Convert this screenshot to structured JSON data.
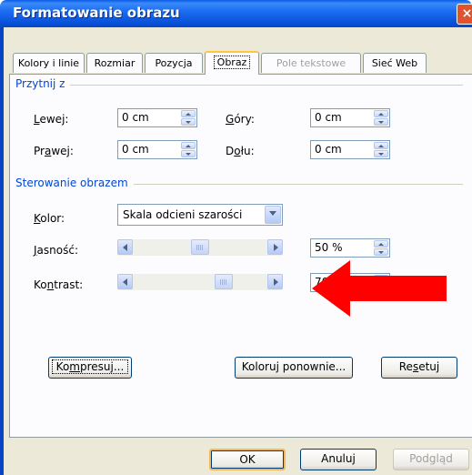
{
  "window": {
    "title": "Formatowanie obrazu",
    "close_glyph": "×"
  },
  "tabs": [
    {
      "label": "Kolory i linie",
      "active": false,
      "disabled": false
    },
    {
      "label": "Rozmiar",
      "active": false,
      "disabled": false
    },
    {
      "label": "Pozycja",
      "active": false,
      "disabled": false
    },
    {
      "label": "Obraz",
      "active": true,
      "disabled": false
    },
    {
      "label": "Pole tekstowe",
      "active": false,
      "disabled": true
    },
    {
      "label": "Sieć Web",
      "active": false,
      "disabled": false
    }
  ],
  "crop": {
    "group_label": "Przytnij z",
    "left": {
      "label_u": "L",
      "label_rest": "ewej:",
      "value": "0 cm"
    },
    "top": {
      "label_u": "G",
      "label_rest": "óry:",
      "value": "0 cm"
    },
    "right": {
      "label_pre": "Pr",
      "label_u": "a",
      "label_rest": "wej:",
      "value": "0 cm"
    },
    "bottom": {
      "label_pre": "D",
      "label_u": "o",
      "label_rest": "łu:",
      "value": "0 cm"
    }
  },
  "image_control": {
    "group_label": "Sterowanie obrazem",
    "color": {
      "label_u": "K",
      "label_rest": "olor:",
      "value": "Skala odcieni szarości"
    },
    "brightness": {
      "label_u": "J",
      "label_rest": "asność:",
      "value": "50 %",
      "level": 0.5
    },
    "contrast": {
      "label_pre": "Ko",
      "label_u": "n",
      "label_rest": "trast:",
      "value": "70 %",
      "level": 0.7
    }
  },
  "buttons": {
    "compress": {
      "pre": "Ko",
      "u": "m",
      "rest": "presuj..."
    },
    "recolor": {
      "pre": "Koloru",
      "u": "j",
      "rest": " ponownie..."
    },
    "reset": {
      "pre": "Re",
      "u": "s",
      "rest": "etuj"
    },
    "ok": "OK",
    "cancel": "Anuluj",
    "preview": "Podgląd"
  },
  "colors": {
    "arrow": "#ff0000",
    "title_bar": "#0a5ae6",
    "group_label": "#0046d5"
  }
}
